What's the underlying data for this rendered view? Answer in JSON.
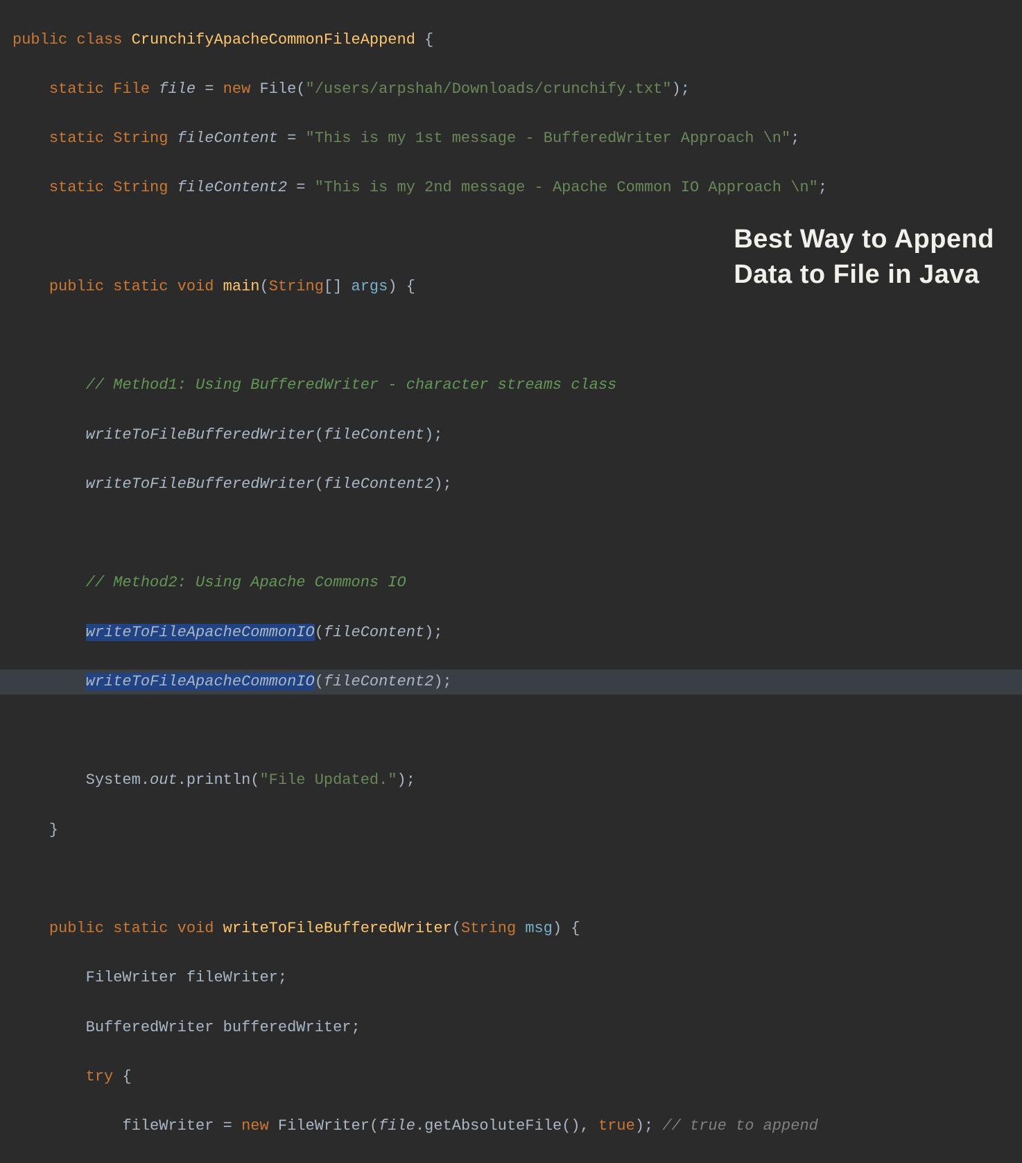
{
  "overlay": {
    "line1": "Best Way to Append",
    "line2": "Data to File in Java"
  },
  "code": {
    "l1": {
      "kw1": "public",
      "kw2": "class",
      "cls": "CrunchifyApacheCommonFileAppend",
      "brace": "{"
    },
    "l2": {
      "kw": "static",
      "type": "File",
      "var": "file",
      "eq": "=",
      "new": "new",
      "ctor": "File",
      "str": "\"/users/arpshah/Downloads/crunchify.txt\"",
      "end": ");"
    },
    "l3": {
      "kw": "static",
      "type": "String",
      "var": "fileContent",
      "eq": "=",
      "str": "\"This is my 1st message - BufferedWriter Approach \\n\"",
      "end": ";"
    },
    "l4": {
      "kw": "static",
      "type": "String",
      "var": "fileContent2",
      "eq": "=",
      "str": "\"This is my 2nd message - Apache Common IO Approach \\n\"",
      "end": ";"
    },
    "l6": {
      "kw1": "public",
      "kw2": "static",
      "kw3": "void",
      "method": "main",
      "lp": "(",
      "ptype": "String",
      "arr": "[]",
      "pname": "args",
      "rp": ")",
      "brace": "{"
    },
    "l8": {
      "comment": "// Method1: Using BufferedWriter - character streams class"
    },
    "l9": {
      "call": "writeToFileBufferedWriter",
      "lp": "(",
      "arg": "fileContent",
      "rp": ");"
    },
    "l10": {
      "call": "writeToFileBufferedWriter",
      "lp": "(",
      "arg": "fileContent2",
      "rp": ");"
    },
    "l12": {
      "comment": "// Method2: Using Apache Commons IO"
    },
    "l13": {
      "call": "writeToFileApacheCommonIO",
      "lp": "(",
      "arg": "fileContent",
      "rp": ");"
    },
    "l14": {
      "call": "writeToFileApacheCommonIO",
      "lp": "(",
      "arg": "fileContent2",
      "rp": ");"
    },
    "l16": {
      "sys": "System",
      "dot1": ".",
      "out": "out",
      "dot2": ".",
      "println": "println",
      "lp": "(",
      "str": "\"File Updated.\"",
      "rp": ");"
    },
    "l17": {
      "brace": "}"
    },
    "l19": {
      "kw1": "public",
      "kw2": "static",
      "kw3": "void",
      "method": "writeToFileBufferedWriter",
      "lp": "(",
      "ptype": "String",
      "pname": "msg",
      "rp": ")",
      "brace": "{"
    },
    "l20": {
      "type": "FileWriter",
      "var": "fileWriter",
      "end": ";"
    },
    "l21": {
      "type": "BufferedWriter",
      "var": "bufferedWriter",
      "end": ";"
    },
    "l22": {
      "kw": "try",
      "brace": "{"
    },
    "l23": {
      "var": "fileWriter",
      "eq": "=",
      "new": "new",
      "ctor": "FileWriter",
      "lp": "(",
      "arg": "file",
      "dot": ".",
      "m": "getAbsoluteFile",
      "rp1": "()",
      "comma": ",",
      "bool": "true",
      "rp2": ");",
      "comment": "// true to append"
    }
  }
}
